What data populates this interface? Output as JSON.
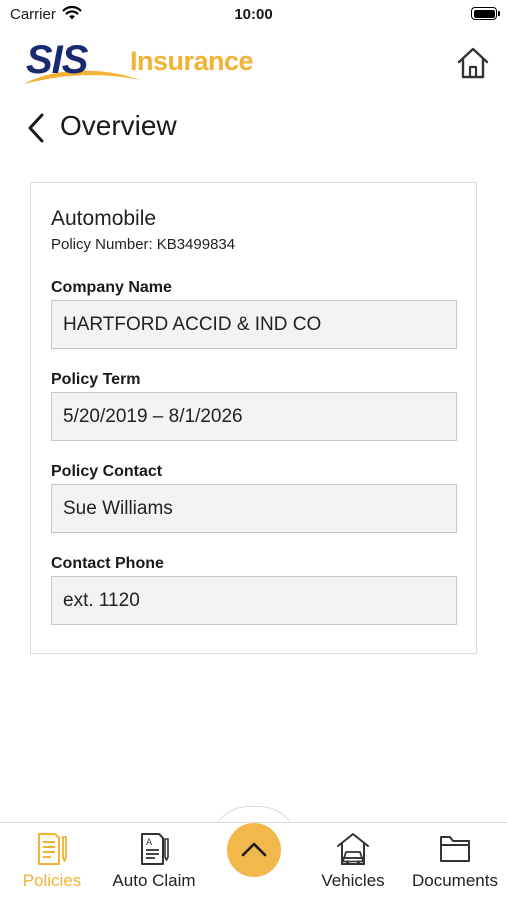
{
  "status_bar": {
    "carrier": "Carrier",
    "time": "10:00",
    "battery_level": 1.0
  },
  "header": {
    "logo_primary": "SIS",
    "logo_secondary": "Insurance",
    "home_icon": "home-icon"
  },
  "page": {
    "back_icon": "chevron-left-icon",
    "title": "Overview"
  },
  "policy": {
    "type": "Automobile",
    "number_label": "Policy Number:",
    "number": "KB3499834",
    "fields": [
      {
        "label": "Company Name",
        "value": "HARTFORD ACCID & IND CO"
      },
      {
        "label": "Policy Term",
        "value": "5/20/2019 – 8/1/2026"
      },
      {
        "label": "Policy Contact",
        "value": "Sue Williams"
      },
      {
        "label": "Contact Phone",
        "value": "ext. 1120"
      }
    ]
  },
  "bottom_nav": {
    "items": [
      {
        "label": "Policies",
        "icon": "policy-document-icon",
        "active": true
      },
      {
        "label": "Auto Claim",
        "icon": "claim-form-icon",
        "active": false
      },
      {
        "label": "Vehicles",
        "icon": "house-car-icon",
        "active": false
      },
      {
        "label": "Documents",
        "icon": "folder-icon",
        "active": false
      }
    ],
    "fab_icon": "chevron-up-icon"
  },
  "colors": {
    "brand_navy": "#1a2a6e",
    "brand_gold": "#f2b233",
    "fab": "#f2b84b",
    "field_bg": "#f3f3f3"
  }
}
